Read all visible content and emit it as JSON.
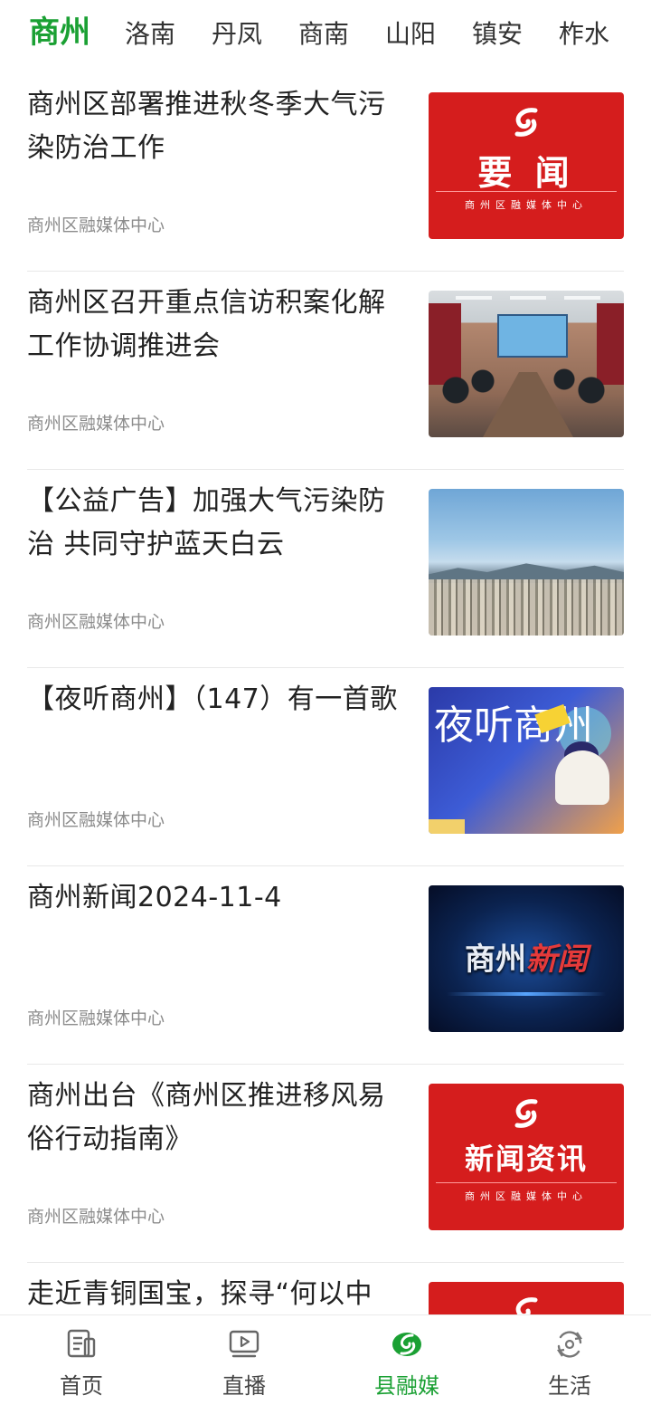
{
  "tabs": [
    {
      "label": "商州",
      "active": true
    },
    {
      "label": "洛南"
    },
    {
      "label": "丹凤"
    },
    {
      "label": "商南"
    },
    {
      "label": "山阳"
    },
    {
      "label": "镇安"
    },
    {
      "label": "柞水"
    }
  ],
  "news": [
    {
      "title": "商州区部署推进秋冬季大气污染防治工作",
      "source": "商州区融媒体中心",
      "thumb": {
        "type": "red-banner",
        "text": "要 闻",
        "sub": "商州区融媒体中心"
      }
    },
    {
      "title": "商州区召开重点信访积案化解工作协调推进会",
      "source": "商州区融媒体中心",
      "thumb": {
        "type": "photo-meeting"
      }
    },
    {
      "title": "【公益广告】加强大气污染防治 共同守护蓝天白云",
      "source": "商州区融媒体中心",
      "thumb": {
        "type": "photo-city"
      }
    },
    {
      "title": "【夜听商州】（147）有一首歌",
      "source": "商州区融媒体中心",
      "thumb": {
        "type": "night-listen",
        "text": "夜听商州"
      }
    },
    {
      "title": "商州新闻2024-11-4",
      "source": "商州区融媒体中心",
      "thumb": {
        "type": "shangzhou-news",
        "text_a": "商州",
        "text_b": "新闻"
      }
    },
    {
      "title": "商州出台《商州区推进移风易俗行动指南》",
      "source": "商州区融媒体中心",
      "thumb": {
        "type": "red-banner",
        "text": "新闻资讯",
        "sub": "商州区融媒体中心"
      }
    },
    {
      "title": "走近青铜国宝，探寻“何以中",
      "source": "",
      "thumb": {
        "type": "red-banner",
        "text": "",
        "sub": ""
      }
    }
  ],
  "bottom_nav": [
    {
      "label": "首页",
      "icon": "home-doc-icon"
    },
    {
      "label": "直播",
      "icon": "live-play-icon"
    },
    {
      "label": "县融媒",
      "icon": "county-media-leaf-icon",
      "active": true
    },
    {
      "label": "生活",
      "icon": "life-refresh-icon"
    }
  ],
  "colors": {
    "accent": "#1aa033",
    "news_red": "#d51d1d"
  }
}
